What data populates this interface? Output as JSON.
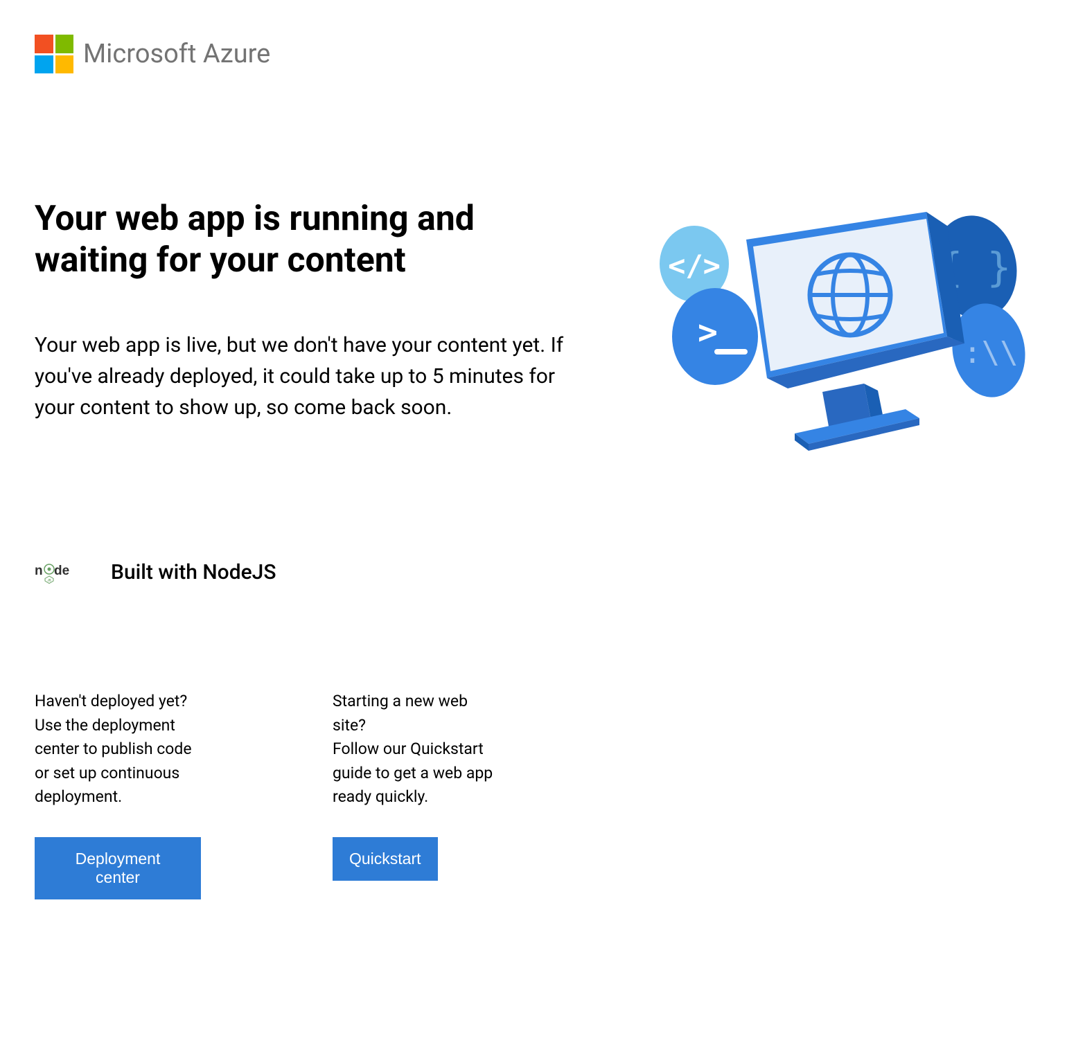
{
  "header": {
    "brand_text": "Microsoft Azure",
    "logo_colors": {
      "top_left": "#f25022",
      "top_right": "#7fba00",
      "bottom_left": "#00a4ef",
      "bottom_right": "#ffb900"
    }
  },
  "main": {
    "title": "Your web app is running and waiting for your content",
    "description": "Your web app is live, but we don't have your content yet. If you've already deployed, it could take up to 5 minutes for your content to show up, so come back soon."
  },
  "built_with": {
    "label": "Built with NodeJS"
  },
  "cards": [
    {
      "title": "Haven't deployed yet?",
      "description": "Use the deployment center to publish code or set up continuous deployment.",
      "button_label": "Deployment center"
    },
    {
      "title": "Starting a new web site?",
      "description": "Follow our Quickstart guide to get a web app ready quickly.",
      "button_label": "Quickstart"
    }
  ],
  "colors": {
    "button_bg": "#2e7cd6",
    "button_text": "#ffffff"
  }
}
